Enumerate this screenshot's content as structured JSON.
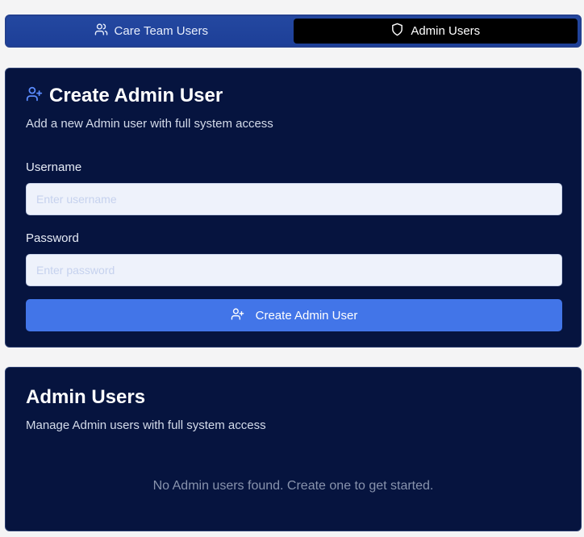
{
  "tabs": [
    {
      "label": "Care Team Users",
      "icon": "users-icon",
      "active": false
    },
    {
      "label": "Admin Users",
      "icon": "shield-icon",
      "active": true
    }
  ],
  "create_card": {
    "title": "Create Admin User",
    "title_icon": "user-plus-icon",
    "subtitle": "Add a new Admin user with full system access",
    "username_label": "Username",
    "username_placeholder": "Enter username",
    "username_value": "",
    "password_label": "Password",
    "password_placeholder": "Enter password",
    "password_value": "",
    "submit_label": "Create Admin User",
    "submit_icon": "user-plus-icon"
  },
  "list_card": {
    "title": "Admin Users",
    "subtitle": "Manage Admin users with full system access",
    "empty_message": "No Admin users found. Create one to get started."
  },
  "colors": {
    "card_bg": "#06143f",
    "tab_bar_bg": "#1d3f98",
    "active_tab_bg": "#000000",
    "primary_button": "#4275e8",
    "icon_accent": "#5b8cff"
  }
}
